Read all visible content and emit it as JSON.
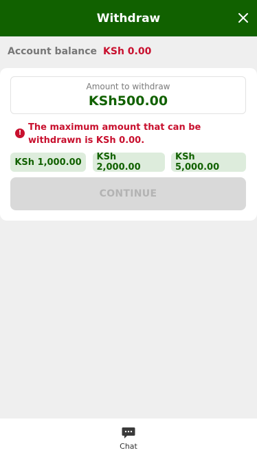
{
  "header": {
    "title": "Withdraw",
    "close_icon": "close-icon"
  },
  "balance": {
    "label": "Account balance",
    "value": "KSh 0.00"
  },
  "amount": {
    "label": "Amount to withdraw",
    "value": "KSh500.00"
  },
  "error": {
    "icon": "alert-icon",
    "message": "The maximum amount that can be withdrawn is KSh 0.00."
  },
  "quick_amounts": [
    {
      "label": "KSh 1,000.00"
    },
    {
      "label": "KSh 2,000.00"
    },
    {
      "label": "KSh 5,000.00"
    }
  ],
  "continue_label": "CONTINUE",
  "footer": {
    "chat_label": "Chat",
    "chat_icon": "chat-icon"
  },
  "colors": {
    "brand_green": "#116100",
    "error_red": "#c8102e",
    "chip_bg": "#ddecdc",
    "disabled_bg": "#d9d9d9"
  }
}
